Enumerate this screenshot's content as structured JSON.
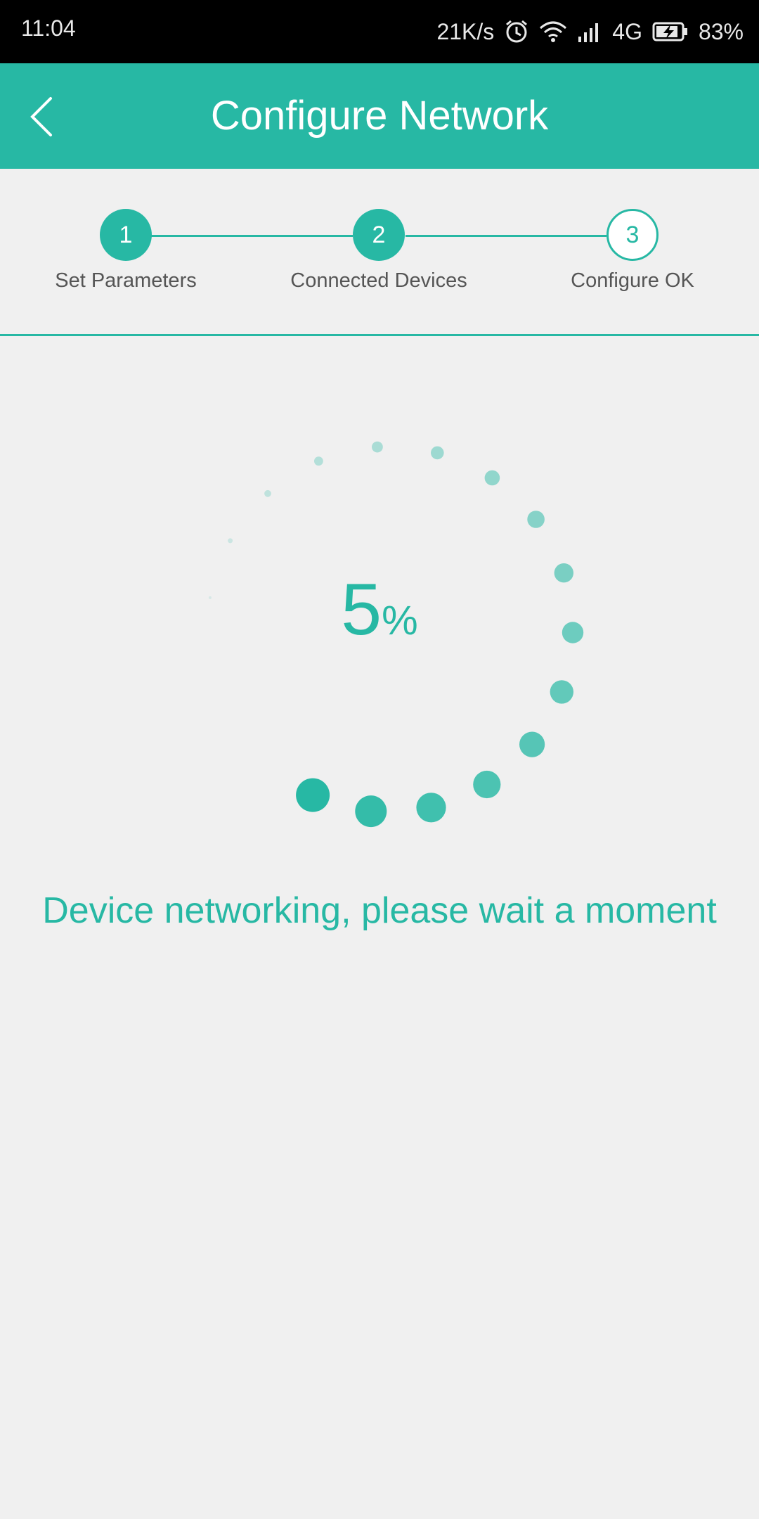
{
  "status_bar": {
    "time": "11:04",
    "net_speed": "21K/s",
    "network_type": "4G",
    "battery": "83%",
    "icons": [
      "alarm-icon",
      "wifi-icon",
      "signal-icon",
      "battery-charging-icon"
    ]
  },
  "header": {
    "title": "Configure Network",
    "back_icon": "chevron-left-icon"
  },
  "steps": [
    {
      "number": "1",
      "label": "Set Parameters",
      "state": "done"
    },
    {
      "number": "2",
      "label": "Connected Devices",
      "state": "done"
    },
    {
      "number": "3",
      "label": "Configure OK",
      "state": "pending"
    }
  ],
  "progress": {
    "value": 5,
    "value_text": "5",
    "unit": "%"
  },
  "message": "Device networking, please wait a moment",
  "colors": {
    "accent": "#27b8a4",
    "background": "#f0f0f0",
    "status_bar": "#000000"
  }
}
